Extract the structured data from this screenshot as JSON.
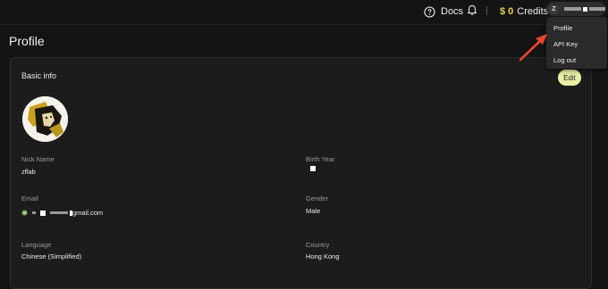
{
  "topbar": {
    "docs_label": "Docs",
    "credits_amount": "$ 0",
    "credits_label": "Credits",
    "user_initial": "Z"
  },
  "page": {
    "title": "Profile"
  },
  "basic_info": {
    "title": "Basic info",
    "edit_label": "Edit",
    "nick_name_label": "Nick Name",
    "nick_name_value": "zflab",
    "birth_year_label": "Birth Year",
    "email_label": "Email",
    "email_value_suffix": "gmail.com",
    "gender_label": "Gender",
    "gender_value": "Male",
    "language_label": "Language",
    "language_value": "Chinese (Simplified)",
    "country_label": "Country",
    "country_value": "Hong Kong"
  },
  "user_menu": {
    "items": [
      "Profile",
      "API Key",
      "Log out"
    ]
  },
  "colors": {
    "background": "#141414",
    "card": "#1c1c1c",
    "accent_credits": "#e9d44c",
    "edit_button": "#eaf0a4",
    "annotation_arrow": "#e8442c"
  },
  "icons": {
    "docs": "help-circle-icon",
    "notifications": "bell-icon",
    "email_verified": "shield-check-icon"
  }
}
